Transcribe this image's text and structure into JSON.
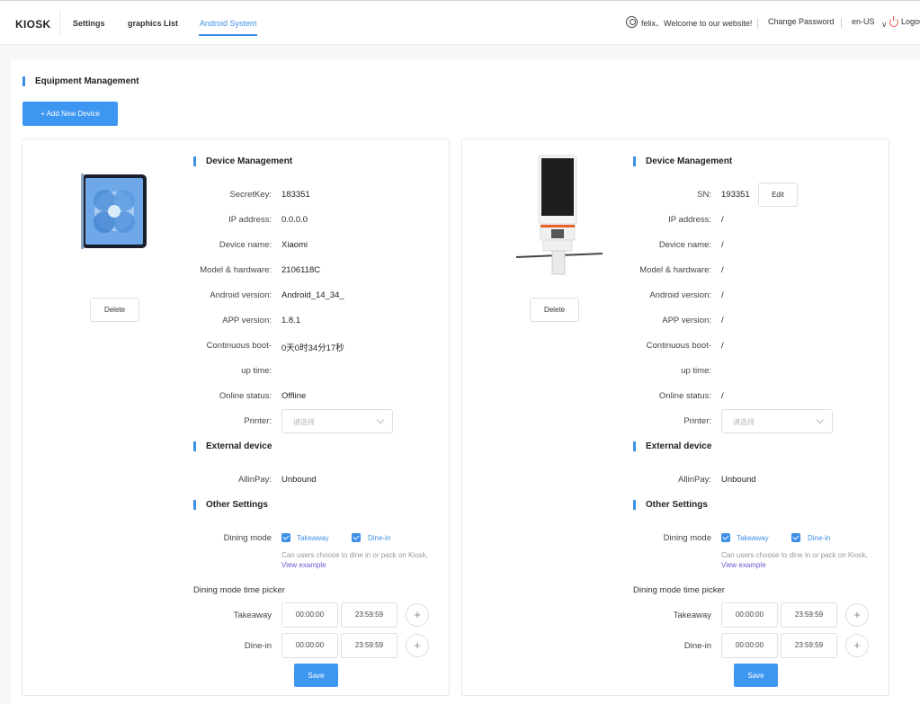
{
  "header": {
    "brand": "KIOSK",
    "nav": [
      "Settings",
      "graphics List",
      "Android System"
    ],
    "welcome": "felix、Welcome to our website!",
    "change_password": "Change Password",
    "language": "en-US",
    "logout": "Logout"
  },
  "page": {
    "title": "Equipment Management",
    "add_button": "+ Add New Device"
  },
  "colors": {
    "accent": "#3d8fe6",
    "danger": "#e65a4e"
  },
  "cards": [
    {
      "device_image": "tablet-image",
      "delete_label": "Delete",
      "sections": {
        "device": "Device Management",
        "external": "External device",
        "other": "Other Settings"
      },
      "fields": [
        {
          "label": "SecretKey:",
          "value": "183351"
        },
        {
          "label": "IP address:",
          "value": "0.0.0.0"
        },
        {
          "label": "Device name:",
          "value": "Xiaomi"
        },
        {
          "label": "Model & hardware:",
          "value": "2106118C"
        },
        {
          "label": "Android version:",
          "value": "Android_14_34_"
        },
        {
          "label": "APP version:",
          "value": "1.8.1"
        },
        {
          "label": "Continuous boot-",
          "value": "0天0时34分17秒"
        },
        {
          "label": "up time:",
          "value": ""
        },
        {
          "label": "Online status:",
          "value": "Offline"
        }
      ],
      "printer_label": "Printer:",
      "printer_placeholder": "请选择",
      "allinpay_label": "AllinPay:",
      "allinpay_value": "Unbound",
      "dining_mode_label": "Dining mode",
      "takeaway_label": "Takeaway",
      "dinein_label": "Dine-in",
      "dining_hint": "Can users choose to dine in or pack on Kiosk,",
      "view_example": "View example",
      "time_picker_title": "Dining mode time picker",
      "takeaway_row": "Takeaway",
      "dinein_row": "Dine-in",
      "takeaway_start": "00:00:00",
      "takeaway_end": "23:59:59",
      "dinein_start": "00:00:00",
      "dinein_end": "23:59:59",
      "save_label": "Save"
    },
    {
      "device_image": "kiosk-image",
      "delete_label": "Delete",
      "edit_label": "Edit",
      "sections": {
        "device": "Device Management",
        "external": "External device",
        "other": "Other Settings"
      },
      "fields": [
        {
          "label": "SN:",
          "value": "193351"
        },
        {
          "label": "IP address:",
          "value": "/"
        },
        {
          "label": "Device name:",
          "value": "/"
        },
        {
          "label": "Model & hardware:",
          "value": "/"
        },
        {
          "label": "Android version:",
          "value": "/"
        },
        {
          "label": "APP version:",
          "value": "/"
        },
        {
          "label": "Continuous boot-",
          "value": "/"
        },
        {
          "label": "up time:",
          "value": ""
        },
        {
          "label": "Online status:",
          "value": "/"
        }
      ],
      "printer_label": "Printer:",
      "printer_placeholder": "请选择",
      "allinpay_label": "AllinPay:",
      "allinpay_value": "Unbound",
      "dining_mode_label": "Dining mode",
      "takeaway_label": "Takeaway",
      "dinein_label": "Dine-in",
      "dining_hint": "Can users choose to dine in or pack on Kiosk,",
      "view_example": "View example",
      "time_picker_title": "Dining mode time picker",
      "takeaway_row": "Takeaway",
      "dinein_row": "Dine-in",
      "takeaway_start": "00:00:00",
      "takeaway_end": "23:59:59",
      "dinein_start": "00:00:00",
      "dinein_end": "23:59:59",
      "save_label": "Save"
    }
  ]
}
